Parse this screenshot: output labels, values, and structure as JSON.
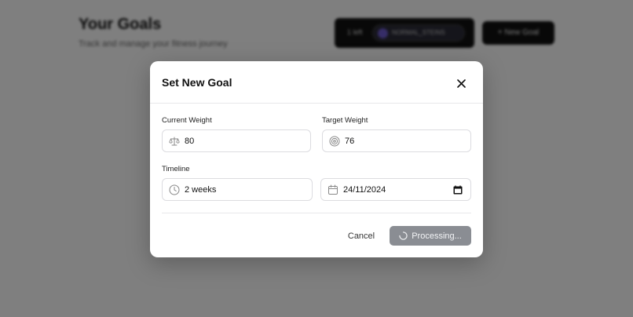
{
  "background": {
    "title": "Your Goals",
    "subtitle": "Track and manage your fitness journey",
    "account_label": "1 left",
    "account_name": "NORMAL_STEINS",
    "new_goal_label": "+  New Goal"
  },
  "modal": {
    "title": "Set New Goal",
    "current_weight": {
      "label": "Current Weight",
      "value": "80",
      "icon": "scale-icon"
    },
    "target_weight": {
      "label": "Target Weight",
      "value": "76",
      "icon": "target-icon"
    },
    "timeline": {
      "label": "Timeline",
      "value": "2 weeks",
      "icon": "clock-icon"
    },
    "date": {
      "value": "24/11/2024",
      "icon": "calendar-icon"
    },
    "cancel_label": "Cancel",
    "submit_label": "Processing..."
  },
  "colors": {
    "overlay": "#7f7f7f",
    "submit_disabled": "#8a8d93",
    "accent_avatar": "#6d5bd0"
  }
}
